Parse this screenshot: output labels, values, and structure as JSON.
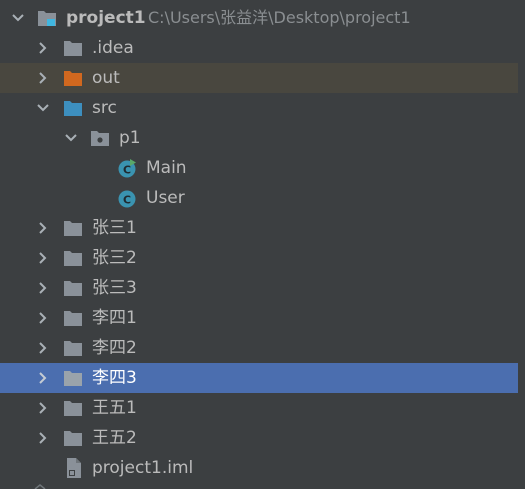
{
  "tree": {
    "root": {
      "label": "project1",
      "path": "C:\\Users\\张益洋\\Desktop\\project1",
      "icon": "project-folder-icon"
    },
    "rows": [
      {
        "label": ".idea",
        "icon": "folder-icon",
        "kind": "folder",
        "expanded": false
      },
      {
        "label": "out",
        "icon": "excluded-folder-icon",
        "kind": "excluded",
        "expanded": false
      },
      {
        "label": "src",
        "icon": "source-folder-icon",
        "kind": "source",
        "expanded": true
      },
      {
        "label": "p1",
        "icon": "package-icon",
        "kind": "package",
        "expanded": true
      },
      {
        "label": "Main",
        "icon": "main-class-icon",
        "kind": "class-main"
      },
      {
        "label": "User",
        "icon": "class-icon",
        "kind": "class"
      },
      {
        "label": "张三1",
        "icon": "folder-icon",
        "kind": "folder",
        "expanded": false
      },
      {
        "label": "张三2",
        "icon": "folder-icon",
        "kind": "folder",
        "expanded": false
      },
      {
        "label": "张三3",
        "icon": "folder-icon",
        "kind": "folder",
        "expanded": false
      },
      {
        "label": "李四1",
        "icon": "folder-icon",
        "kind": "folder",
        "expanded": false
      },
      {
        "label": "李四2",
        "icon": "folder-icon",
        "kind": "folder",
        "expanded": false
      },
      {
        "label": "李四3",
        "icon": "folder-icon",
        "kind": "folder",
        "expanded": false,
        "selected": true
      },
      {
        "label": "王五1",
        "icon": "folder-icon",
        "kind": "folder",
        "expanded": false
      },
      {
        "label": "王五2",
        "icon": "folder-icon",
        "kind": "folder",
        "expanded": false
      },
      {
        "label": "project1.iml",
        "icon": "module-file-icon",
        "kind": "file"
      }
    ]
  },
  "colors": {
    "background": "#3c3f41",
    "selection": "#4b6eaf",
    "excluded_row": "#49473f",
    "folder": "#8a9199",
    "excluded_folder": "#d1681f",
    "source_folder": "#3d8fbf",
    "class_icon": "#3a93b0",
    "text": "#bbbbbb",
    "path_text": "#8a8e91"
  }
}
